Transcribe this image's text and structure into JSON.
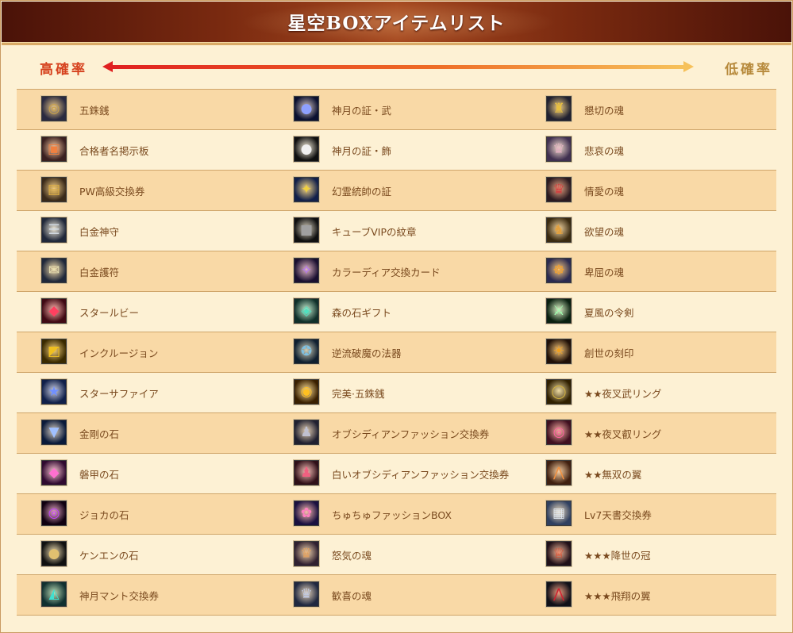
{
  "header": {
    "title": "星空BOXアイテムリスト"
  },
  "rate": {
    "high_label": "高確率",
    "low_label": "低確率"
  },
  "items": [
    [
      "五銖銭",
      "神月の証・武",
      "懇切の魂"
    ],
    [
      "合格者名掲示板",
      "神月の証・飾",
      "悲哀の魂"
    ],
    [
      "PW高級交換券",
      "幻霊統帥の証",
      "情愛の魂"
    ],
    [
      "白金神守",
      "キューブVIPの紋章",
      "欲望の魂"
    ],
    [
      "白金護符",
      "カラーディア交換カード",
      "卑屈の魂"
    ],
    [
      "スタールビー",
      "森の石ギフト",
      "夏風の令剣"
    ],
    [
      "インクルージョン",
      "逆流破魔の法器",
      "創世の刻印"
    ],
    [
      "スターサファイア",
      "完美·五銖銭",
      "★★夜叉武リング"
    ],
    [
      "金剛の石",
      "オブシディアンファッション交換券",
      "★★夜叉叡リング"
    ],
    [
      "磐甲の石",
      "白いオブシディアンファッション交換券",
      "★★無双の翼"
    ],
    [
      "ジョカの石",
      "ちゅちゅファッションBOX",
      "Lv7天書交換券"
    ],
    [
      "ケンエンの石",
      "怒気の魂",
      "★★★降世の冠"
    ],
    [
      "神月マント交換券",
      "歓喜の魂",
      "★★★飛翔の翼"
    ]
  ],
  "icons": [
    [
      {
        "icon": "coin-icon",
        "bg": "#2a2a40",
        "fg": "#c9a24a",
        "glyph": "◎"
      },
      {
        "icon": "blue-orb-icon",
        "bg": "#0b1030",
        "fg": "#8ea0ff",
        "glyph": "●"
      },
      {
        "icon": "golden-figure-icon",
        "bg": "#202030",
        "fg": "#e8c040",
        "glyph": "♜"
      }
    ],
    [
      {
        "icon": "board-icon",
        "bg": "#3a2020",
        "fg": "#f08040",
        "glyph": "▣"
      },
      {
        "icon": "white-orb-icon",
        "bg": "#101010",
        "fg": "#f0f0f0",
        "glyph": "●"
      },
      {
        "icon": "doll-figure-icon",
        "bg": "#403050",
        "fg": "#e0b0c0",
        "glyph": "♛"
      }
    ],
    [
      {
        "icon": "ticket-icon",
        "bg": "#3a2a1a",
        "fg": "#e0b040",
        "glyph": "▤"
      },
      {
        "icon": "emblem-icon",
        "bg": "#12204a",
        "fg": "#f0d040",
        "glyph": "✦"
      },
      {
        "icon": "red-figure-icon",
        "bg": "#2a1a20",
        "fg": "#d04040",
        "glyph": "♛"
      }
    ],
    [
      {
        "icon": "scroll-icon",
        "bg": "#20283a",
        "fg": "#d0d8e0",
        "glyph": "☰"
      },
      {
        "icon": "cube-icon",
        "bg": "#101010",
        "fg": "#a0a0a0",
        "glyph": "■"
      },
      {
        "icon": "gold-statue-icon",
        "bg": "#3a2a10",
        "fg": "#e0a040",
        "glyph": "♞"
      }
    ],
    [
      {
        "icon": "paper-charm-icon",
        "bg": "#20283a",
        "fg": "#e8e0b0",
        "glyph": "✉"
      },
      {
        "icon": "card-icon",
        "bg": "#1a1030",
        "fg": "#b070ff",
        "glyph": "✧"
      },
      {
        "icon": "gold-imp-icon",
        "bg": "#2a2a50",
        "fg": "#f0a030",
        "glyph": "☸"
      }
    ],
    [
      {
        "icon": "ruby-icon",
        "bg": "#400a14",
        "fg": "#ff4060",
        "glyph": "◆"
      },
      {
        "icon": "green-gift-icon",
        "bg": "#10302a",
        "fg": "#50e0c0",
        "glyph": "◈"
      },
      {
        "icon": "sword-icon",
        "bg": "#0a2010",
        "fg": "#a0ffb0",
        "glyph": "⚔"
      }
    ],
    [
      {
        "icon": "inclusion-icon",
        "bg": "#3a2a00",
        "fg": "#f0c020",
        "glyph": "◩"
      },
      {
        "icon": "artifact-icon",
        "bg": "#102030",
        "fg": "#80c0e0",
        "glyph": "✪"
      },
      {
        "icon": "seal-icon",
        "bg": "#201008",
        "fg": "#f0a020",
        "glyph": "☀"
      }
    ],
    [
      {
        "icon": "sapphire-icon",
        "bg": "#10204a",
        "fg": "#7090ff",
        "glyph": "★"
      },
      {
        "icon": "gold-coin-icon",
        "bg": "#3a2000",
        "fg": "#ffc020",
        "glyph": "◉"
      },
      {
        "icon": "ring-icon",
        "bg": "#302000",
        "fg": "#d0b040",
        "glyph": "◯"
      }
    ],
    [
      {
        "icon": "diamond-icon",
        "bg": "#0a1a3a",
        "fg": "#a0c0ff",
        "glyph": "▼"
      },
      {
        "icon": "outfit-icon",
        "bg": "#202030",
        "fg": "#c0c0d0",
        "glyph": "♟"
      },
      {
        "icon": "pink-ring-icon",
        "bg": "#401020",
        "fg": "#ff60a0",
        "glyph": "◎"
      }
    ],
    [
      {
        "icon": "pink-gem-icon",
        "bg": "#300a30",
        "fg": "#ff70d0",
        "glyph": "◆"
      },
      {
        "icon": "white-outfit-icon",
        "bg": "#301018",
        "fg": "#f06080",
        "glyph": "♟"
      },
      {
        "icon": "wings-icon",
        "bg": "#402010",
        "fg": "#f09040",
        "glyph": "⋀"
      }
    ],
    [
      {
        "icon": "dark-ring-icon",
        "bg": "#100010",
        "fg": "#c040ff",
        "glyph": "◎"
      },
      {
        "icon": "fashion-box-icon",
        "bg": "#1a1040",
        "fg": "#ff80c0",
        "glyph": "✿"
      },
      {
        "icon": "book-icon",
        "bg": "#304060",
        "fg": "#e0e8f0",
        "glyph": "▦"
      }
    ],
    [
      {
        "icon": "pearl-icon",
        "bg": "#101010",
        "fg": "#e0c070",
        "glyph": "●"
      },
      {
        "icon": "angry-figure-icon",
        "bg": "#302030",
        "fg": "#e0a060",
        "glyph": "♛"
      },
      {
        "icon": "crown-icon",
        "bg": "#201018",
        "fg": "#e04020",
        "glyph": "♕"
      }
    ],
    [
      {
        "icon": "cape-icon",
        "bg": "#103030",
        "fg": "#40e0d0",
        "glyph": "◭"
      },
      {
        "icon": "joy-figure-icon",
        "bg": "#202840",
        "fg": "#c0c8e0",
        "glyph": "♛"
      },
      {
        "icon": "flying-wings-icon",
        "bg": "#101018",
        "fg": "#d02030",
        "glyph": "⋀"
      }
    ]
  ]
}
